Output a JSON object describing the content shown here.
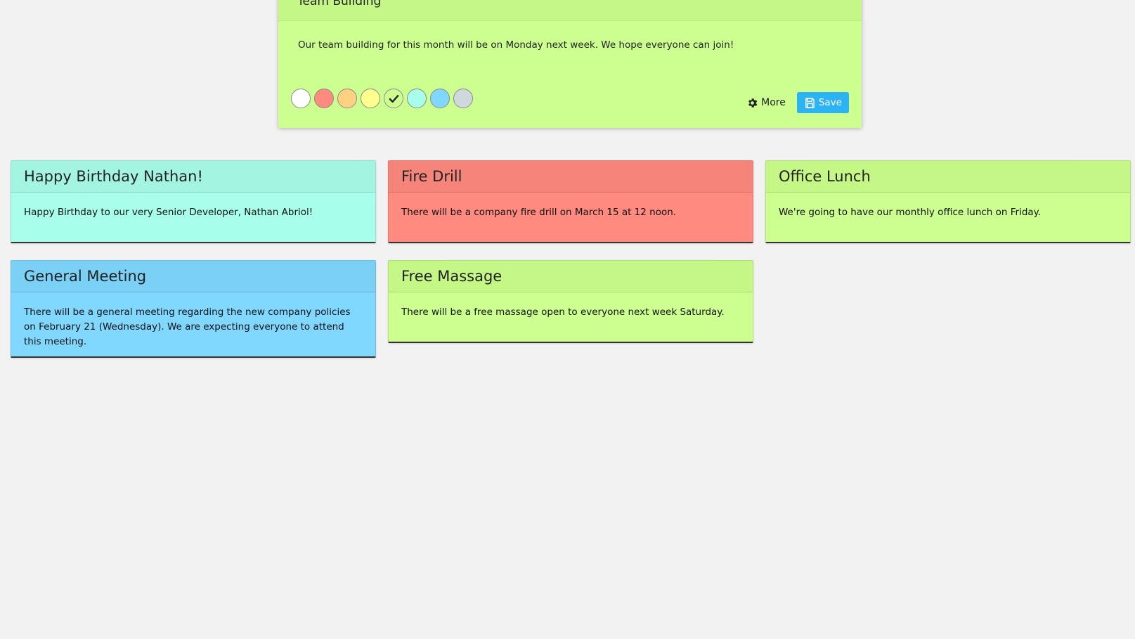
{
  "editor": {
    "title": "Team Building",
    "body": "Our team building for this month will be on Monday next week. We hope everyone can join!",
    "header_color": "#c5f787",
    "body_color": "#ccff90",
    "swatches": [
      {
        "name": "white",
        "color": "#ffffff",
        "selected": false
      },
      {
        "name": "red",
        "color": "#ff8a80",
        "selected": false
      },
      {
        "name": "orange",
        "color": "#ffd180",
        "selected": false
      },
      {
        "name": "yellow",
        "color": "#ffff8d",
        "selected": false
      },
      {
        "name": "green",
        "color": "#ccff90",
        "selected": true
      },
      {
        "name": "teal",
        "color": "#a7ffeb",
        "selected": false
      },
      {
        "name": "blue",
        "color": "#80d8ff",
        "selected": false
      },
      {
        "name": "gray",
        "color": "#cfd8dc",
        "selected": false
      }
    ],
    "more_label": "More",
    "more_icon": "gear-icon",
    "save_label": "Save",
    "save_icon": "floppy-disk-icon",
    "save_color": "#2bb3f3"
  },
  "notes": [
    {
      "title": "Happy Birthday Nathan!",
      "body": "Happy Birthday to our very Senior Developer, Nathan Abriol!",
      "header_color": "#a3f5e2",
      "body_color": "#a7ffeb"
    },
    {
      "title": "Fire Drill",
      "body": "There will be a company fire drill on March 15 at 12 noon.",
      "header_color": "#f5857b",
      "body_color": "#ff8a80"
    },
    {
      "title": "Office Lunch",
      "body": "We're going to have our monthly office lunch on Friday.",
      "header_color": "#c5f787",
      "body_color": "#ccff90"
    },
    {
      "title": "General Meeting",
      "body": "There will be a general meeting regarding the new company policies on February 21 (Wednesday). We are expecting everyone to attend this meeting.",
      "header_color": "#7bd0f5",
      "body_color": "#80d8ff"
    },
    {
      "title": "Free Massage",
      "body": "There will be a free massage open to everyone next week Saturday.",
      "header_color": "#c5f787",
      "body_color": "#ccff90"
    }
  ]
}
